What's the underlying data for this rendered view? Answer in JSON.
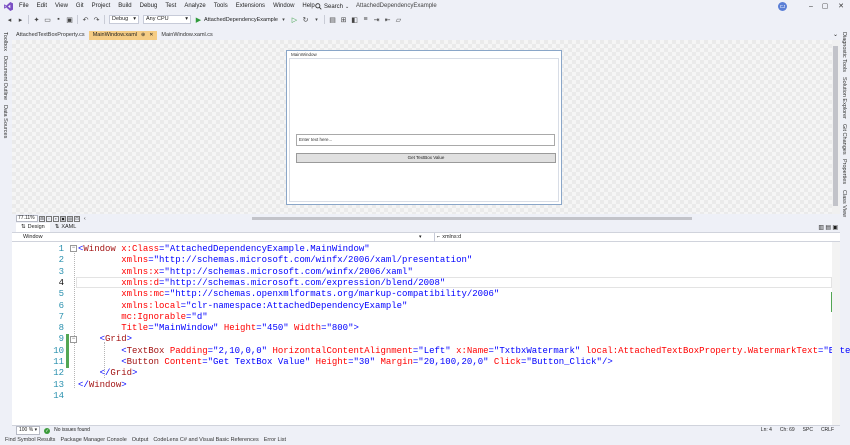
{
  "menubar": {
    "items": [
      "File",
      "Edit",
      "View",
      "Git",
      "Project",
      "Build",
      "Debug",
      "Test",
      "Analyze",
      "Tools",
      "Extensions",
      "Window",
      "Help"
    ],
    "search_label": "Search",
    "solution_title": "AttachedDependencyExample",
    "user_initials": "CJ"
  },
  "toolbar": {
    "configuration": "Debug",
    "platform": "Any CPU",
    "run_target": "AttachedDependencyExample"
  },
  "left_tool_tabs": [
    "Toolbox",
    "Document Outline",
    "Data Sources"
  ],
  "right_tool_tabs": [
    "Diagnostic Tools",
    "Solution Explorer",
    "Git Changes",
    "Properties",
    "Class View"
  ],
  "doc_tabs": [
    {
      "label": "AttachedTextBoxProperty.cs",
      "active": false
    },
    {
      "label": "MainWindow.xaml",
      "active": true,
      "close": "✕"
    },
    {
      "label": "MainWindow.xaml.cs",
      "active": false
    }
  ],
  "designer": {
    "window_title": "MainWindow",
    "textbox_watermark": "Enter text here...",
    "button_label": "Get TextBox Value",
    "zoom": "77.11%"
  },
  "view_tabs": {
    "design": "Design",
    "xaml": "XAML"
  },
  "navbar": {
    "left": "Window",
    "right": "xmlns:d"
  },
  "code_lines": [
    {
      "n": "1",
      "parts": [
        [
          "b",
          "<"
        ],
        [
          "m",
          "Window"
        ],
        [
          "r",
          " x:Class"
        ],
        [
          "b",
          "=\"AttachedDependencyExample.MainWindow\""
        ]
      ]
    },
    {
      "n": "2",
      "parts": [
        [
          "r",
          "        xmlns"
        ],
        [
          "b",
          "=\"http://schemas.microsoft.com/winfx/2006/xaml/presentation\""
        ]
      ]
    },
    {
      "n": "3",
      "parts": [
        [
          "r",
          "        xmlns:x"
        ],
        [
          "b",
          "=\"http://schemas.microsoft.com/winfx/2006/xaml\""
        ]
      ]
    },
    {
      "n": "4",
      "parts": [
        [
          "r",
          "        xmlns:d"
        ],
        [
          "b",
          "=\"http://schemas.microsoft.com/expression/blend/2008\""
        ]
      ]
    },
    {
      "n": "5",
      "parts": [
        [
          "r",
          "        xmlns:mc"
        ],
        [
          "b",
          "=\"http://schemas.openxmlformats.org/markup-compatibility/2006\""
        ]
      ]
    },
    {
      "n": "6",
      "parts": [
        [
          "r",
          "        xmlns:local"
        ],
        [
          "b",
          "=\"clr-namespace:AttachedDependencyExample\""
        ]
      ]
    },
    {
      "n": "7",
      "parts": [
        [
          "r",
          "        mc:Ignorable"
        ],
        [
          "b",
          "=\"d\""
        ]
      ]
    },
    {
      "n": "8",
      "parts": [
        [
          "r",
          "        Title"
        ],
        [
          "b",
          "=\"MainWindow\""
        ],
        [
          "r",
          " Height"
        ],
        [
          "b",
          "=\"450\""
        ],
        [
          "r",
          " Width"
        ],
        [
          "b",
          "=\"800\">"
        ]
      ]
    },
    {
      "n": "9",
      "parts": [
        [
          "b",
          "    <"
        ],
        [
          "m",
          "Grid"
        ],
        [
          "b",
          ">"
        ]
      ]
    },
    {
      "n": "10",
      "parts": [
        [
          "b",
          "        <"
        ],
        [
          "m",
          "TextBox"
        ],
        [
          "r",
          " Padding"
        ],
        [
          "b",
          "=\"2,10,0,0\""
        ],
        [
          "r",
          " HorizontalContentAlignment"
        ],
        [
          "b",
          "=\"Left\""
        ],
        [
          "r",
          " x:Name"
        ],
        [
          "b",
          "=\"TxtbxWatermark\""
        ],
        [
          "r",
          " local:AttachedTextBoxProperty.WatermarkText"
        ],
        [
          "b",
          "=\"Enter text"
        ]
      ]
    },
    {
      "n": "11",
      "parts": [
        [
          "b",
          "        <"
        ],
        [
          "m",
          "Button"
        ],
        [
          "r",
          " Content"
        ],
        [
          "b",
          "=\"Get TextBox Value\""
        ],
        [
          "r",
          " Height"
        ],
        [
          "b",
          "=\"30\""
        ],
        [
          "r",
          " Margin"
        ],
        [
          "b",
          "=\"20,100,20,0\""
        ],
        [
          "r",
          " Click"
        ],
        [
          "b",
          "=\"Button_Click\""
        ],
        [
          "b",
          "/>"
        ]
      ]
    },
    {
      "n": "12",
      "parts": [
        [
          "b",
          "    </"
        ],
        [
          "m",
          "Grid"
        ],
        [
          "b",
          ">"
        ]
      ]
    },
    {
      "n": "13",
      "parts": [
        [
          "b",
          "</"
        ],
        [
          "m",
          "Window"
        ],
        [
          "b",
          ">"
        ]
      ]
    },
    {
      "n": "14",
      "parts": []
    }
  ],
  "editor_status": {
    "zoom": "100 %",
    "issues": "No issues found",
    "line": "Ln: 4",
    "col": "Ch: 69",
    "spc": "SPC",
    "eol": "CRLF"
  },
  "bottom_tabs": [
    "Find Symbol Results",
    "Package Manager Console",
    "Output",
    "CodeLens C# and Visual Basic References",
    "Error List"
  ],
  "colors": {
    "accent": "#f5cc84",
    "keyword_blue": "#0000ff",
    "element_maroon": "#a31515",
    "attr_red": "#ff0000",
    "line_number": "#2b91af"
  }
}
